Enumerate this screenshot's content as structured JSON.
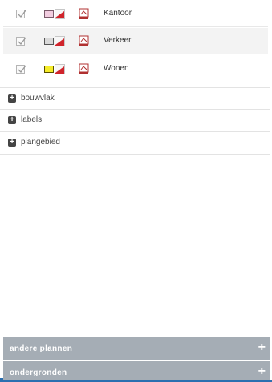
{
  "layers": [
    {
      "label": "Kantoor",
      "swatch_color": "#f2cde0",
      "swatch_border": "#7a5a6a"
    },
    {
      "label": "Verkeer",
      "swatch_color": "#d9d9d9",
      "swatch_border": "#555555"
    },
    {
      "label": "Wonen",
      "swatch_color": "#f5ec2a",
      "swatch_border": "#5a5000"
    }
  ],
  "groups": [
    {
      "label": "bouwvlak"
    },
    {
      "label": "labels"
    },
    {
      "label": "plangebied"
    }
  ],
  "accordion": {
    "other_plans": "andere plannen",
    "basemaps": "ondergronden",
    "expand_symbol": "+"
  },
  "expand_symbol": "+",
  "colors": {
    "accordion_bg": "#a5adb5",
    "accent_blue": "#2b6fb0",
    "legend_red": "#d0242b"
  }
}
